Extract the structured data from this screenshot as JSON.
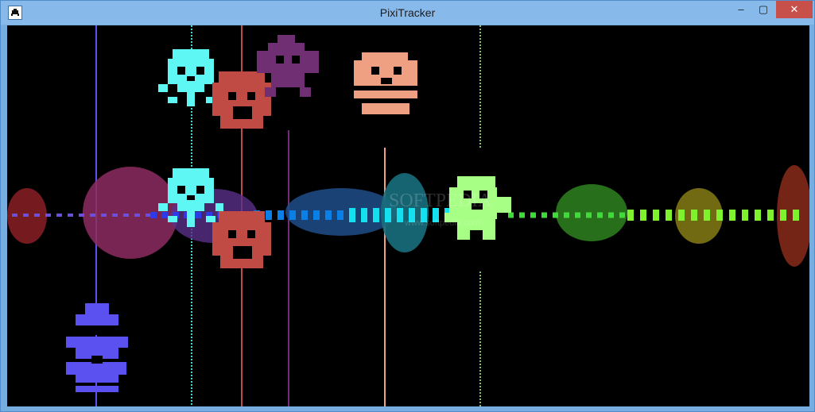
{
  "window": {
    "title": "PixiTracker",
    "icon": "pixel-invader-icon",
    "controls": {
      "minimize": "–",
      "maximize": "▢",
      "close": "✕"
    }
  },
  "colors": {
    "titlebar": "#87b9ea",
    "border": "#77aee2",
    "close": "#c7504b",
    "canvas_bg": "#000000",
    "cyan": "#5ff7f4",
    "orange": "#f0a082",
    "red": "#c04b44",
    "purple": "#6f2f72",
    "blue": "#5a51f0",
    "green": "#a8ff85",
    "dark_red": "#8a1f24"
  },
  "canvas": {
    "watermark": "SOFTPEDIA",
    "watermark_sub": "www.softpedia.com"
  }
}
